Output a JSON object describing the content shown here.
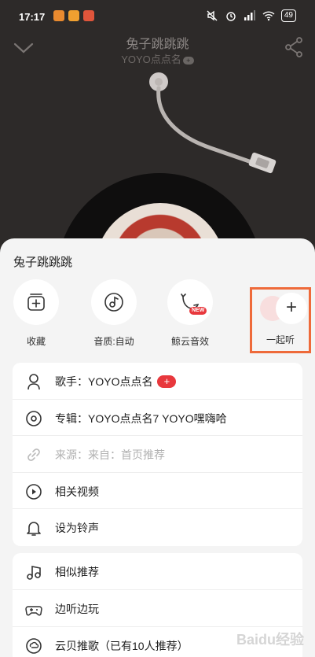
{
  "status_bar": {
    "time": "17:17",
    "battery": "49"
  },
  "player": {
    "song_title": "兔子跳跳跳",
    "artist": "YOYO点点名",
    "artist_badge": "+"
  },
  "sheet": {
    "title": "兔子跳跳跳",
    "quick_actions": [
      {
        "label": "收藏",
        "icon": "add-to-playlist-icon"
      },
      {
        "label": "音质:自动",
        "icon": "music-note-icon"
      },
      {
        "label": "鲸云音效",
        "icon": "whale-icon",
        "badge": "NEW"
      },
      {
        "label": "一起听",
        "icon": "plus-icon",
        "plus": "+"
      }
    ],
    "menu_group_1": [
      {
        "label": "歌手：YOYO点点名",
        "badge": "+",
        "icon": "singer-icon"
      },
      {
        "label": "专辑：YOYO点点名7 YOYO嘿嗨哈",
        "icon": "album-icon"
      },
      {
        "label": "来源：来自：首页推荐",
        "icon": "link-icon",
        "disabled": true
      },
      {
        "label": "相关视频",
        "icon": "video-play-icon"
      },
      {
        "label": "设为铃声",
        "icon": "bell-icon"
      }
    ],
    "menu_group_2": [
      {
        "label": "相似推荐",
        "icon": "similar-music-icon"
      },
      {
        "label": "边听边玩",
        "icon": "gamepad-icon"
      },
      {
        "label": "云贝推歌（已有10人推荐）",
        "icon": "cloud-coin-icon"
      }
    ]
  },
  "watermark": "Baidu经验",
  "colors": {
    "accent_red": "#e8383d",
    "highlight_box": "#ee6a3a",
    "sheet_bg": "#f4f4f4",
    "player_bg": "#2d2a29"
  }
}
